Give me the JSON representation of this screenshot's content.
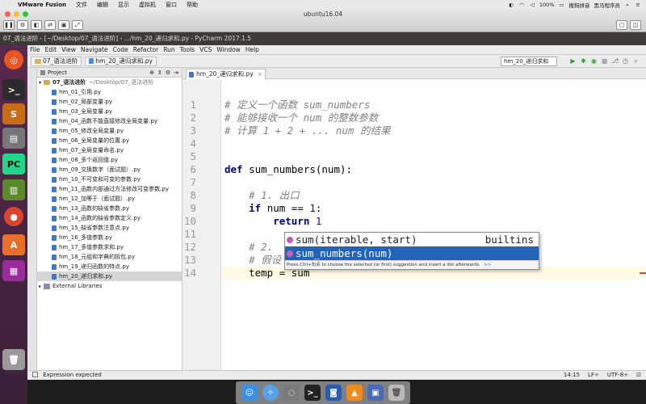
{
  "mac_menubar": {
    "app": "VMware Fusion",
    "items": [
      "文件",
      "编辑",
      "显示",
      "虚拟机",
      "窗口",
      "帮助"
    ],
    "battery": "100%",
    "input_method": "搜狗拼音",
    "user": "黑马程序员"
  },
  "vmware": {
    "window_title": "ubuntu16.04"
  },
  "pycharm": {
    "window_title": "07_语法进阶 - [~/Desktop/07_语法进阶] - .../hm_20_递归求和.py - PyCharm 2017.1.5",
    "menu": [
      "File",
      "Edit",
      "View",
      "Navigate",
      "Code",
      "Refactor",
      "Run",
      "Tools",
      "VCS",
      "Window",
      "Help"
    ],
    "breadcrumbs": [
      "07_语法进阶",
      "hm_20_递归求和.py"
    ],
    "run_config": "hm_20_递归求和",
    "project_panel": {
      "header": "Project",
      "root_name": "07_语法进阶",
      "root_path": "~/Desktop/07_语法进阶",
      "files": [
        "hm_01_引用.py",
        "hm_02_局部变量.py",
        "hm_03_全局变量.py",
        "hm_04_函数不能直接修改全局变量.py",
        "hm_05_修改全局变量.py",
        "hm_06_全局变量的位置.py",
        "hm_07_全局变量命名.py",
        "hm_08_多个返回值.py",
        "hm_09_交换数字（面试题）.py",
        "hm_10_不可变和可变的参数.py",
        "hm_11_函数内部通过方法修改可变参数.py",
        "hm_12_加等于（面试题）.py",
        "hm_13_函数的缺省参数.py",
        "hm_14_函数的缺省参数定义.py",
        "hm_15_缺省参数注意点.py",
        "hm_16_多值参数.py",
        "hm_17_多值参数求和.py",
        "hm_18_元组和字典的拆包.py",
        "hm_19_递归函数的特点.py",
        "hm_20_递归求和.py"
      ],
      "selected_index": 19,
      "external": "External Libraries"
    },
    "editor": {
      "tab_label": "hm_20_递归求和.py",
      "line_numbers": [
        "1",
        "2",
        "3",
        "4",
        "5",
        "6",
        "7",
        "8",
        "9",
        "10",
        "11",
        "12",
        "13",
        "14"
      ],
      "lines": [
        "# 定义一个函数 sum_numbers",
        "# 能够接收一个 num 的整数参数",
        "# 计算 1 + 2 + ... num 的结果",
        "",
        "",
        "def sum_numbers(num):",
        "",
        "    # 1. 出口",
        "    if num == 1:",
        "        return 1",
        "",
        "    # 2.",
        "    # 假设",
        "    temp = sum"
      ],
      "current_line": 14
    },
    "completion": {
      "items": [
        {
          "text": "sum(iterable, start)",
          "type": "builtins"
        },
        {
          "text": "sum_numbers(num)",
          "type": ""
        }
      ],
      "selected": 1,
      "hint": "Press Ctrl+句点 to choose the selected (or first) suggestion and insert a dot afterwards",
      "hint_link": ">>"
    },
    "status": {
      "message": "Expression expected",
      "position": "14:15",
      "line_sep": "LF÷",
      "encoding": "UTF-8÷"
    }
  },
  "colors": {
    "launcher": "#4a2545",
    "selection": "#2463b8",
    "comment": "#808080",
    "keyword": "#000080",
    "number": "#0000ff"
  }
}
